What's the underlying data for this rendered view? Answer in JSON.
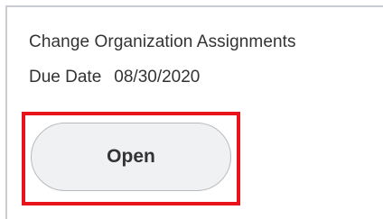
{
  "task": {
    "title": "Change Organization Assignments",
    "due_label": "Due Date",
    "due_value": "08/30/2020"
  },
  "actions": {
    "open_label": "Open"
  },
  "colors": {
    "highlight": "#e8141b",
    "button_bg": "#f0f1f2",
    "text": "#333333"
  }
}
